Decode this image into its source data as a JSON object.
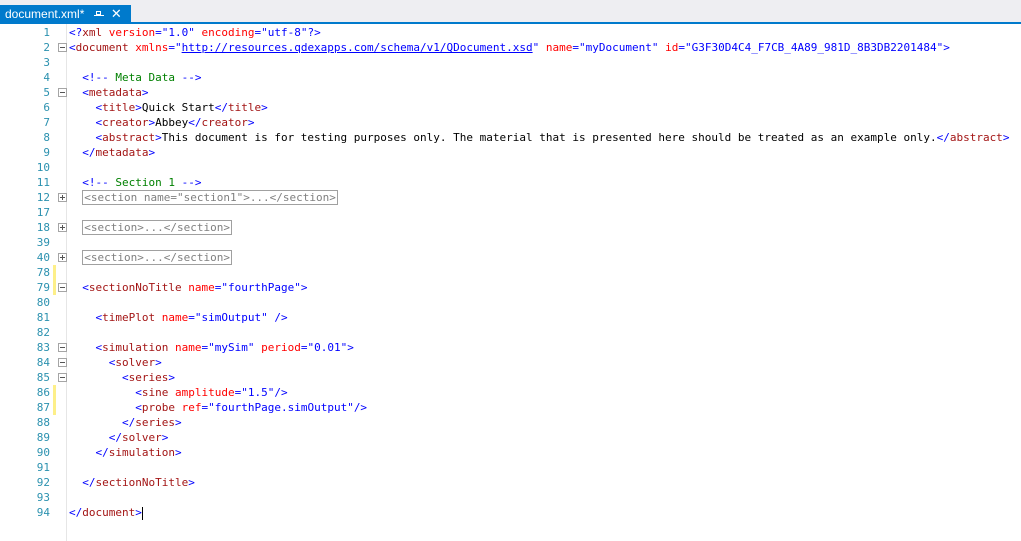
{
  "tab": {
    "title": "document.xml*",
    "pin_icon": "pin-icon",
    "close_label": "✕"
  },
  "colors": {
    "tab_active": "#007acc",
    "line_number": "#2b91af",
    "tag": "#a31515",
    "attribute": "#ff0000",
    "value": "#0000ff",
    "comment": "#008000",
    "changed_marker": "#fdef89"
  },
  "lines": [
    {
      "n": "1",
      "fold": "",
      "changed": false,
      "indent": 0,
      "tokens": [
        [
          "blue",
          "<?"
        ],
        [
          "tag",
          "xml"
        ],
        [
          "attr",
          " version"
        ],
        [
          "blue",
          "="
        ],
        [
          "blue",
          "\""
        ],
        [
          "val",
          "1.0"
        ],
        [
          "blue",
          "\""
        ],
        [
          "attr",
          " encoding"
        ],
        [
          "blue",
          "="
        ],
        [
          "blue",
          "\""
        ],
        [
          "val",
          "utf-8"
        ],
        [
          "blue",
          "\""
        ],
        [
          "blue",
          "?>"
        ]
      ]
    },
    {
      "n": "2",
      "fold": "open",
      "changed": false,
      "indent": 0,
      "tokens": [
        [
          "blue",
          "<"
        ],
        [
          "tag",
          "document"
        ],
        [
          "attr",
          " xmlns"
        ],
        [
          "blue",
          "="
        ],
        [
          "blue",
          "\""
        ],
        [
          "link",
          "http://resources.qdexapps.com/schema/v1/QDocument.xsd"
        ],
        [
          "blue",
          "\""
        ],
        [
          "attr",
          " name"
        ],
        [
          "blue",
          "="
        ],
        [
          "blue",
          "\""
        ],
        [
          "val",
          "myDocument"
        ],
        [
          "blue",
          "\""
        ],
        [
          "attr",
          " id"
        ],
        [
          "blue",
          "="
        ],
        [
          "blue",
          "\""
        ],
        [
          "val",
          "G3F30D4C4_F7CB_4A89_981D_8B3DB2201484"
        ],
        [
          "blue",
          "\""
        ],
        [
          "blue",
          ">"
        ]
      ]
    },
    {
      "n": "3",
      "fold": "",
      "changed": false,
      "indent": 0,
      "tokens": []
    },
    {
      "n": "4",
      "fold": "",
      "changed": false,
      "indent": 2,
      "tokens": [
        [
          "blue",
          "<!--"
        ],
        [
          "com",
          " Meta Data "
        ],
        [
          "blue",
          "-->"
        ]
      ]
    },
    {
      "n": "5",
      "fold": "open",
      "changed": false,
      "indent": 2,
      "tokens": [
        [
          "blue",
          "<"
        ],
        [
          "tag",
          "metadata"
        ],
        [
          "blue",
          ">"
        ]
      ]
    },
    {
      "n": "6",
      "fold": "",
      "changed": false,
      "indent": 4,
      "tokens": [
        [
          "blue",
          "<"
        ],
        [
          "tag",
          "title"
        ],
        [
          "blue",
          ">"
        ],
        [
          "text",
          "Quick Start"
        ],
        [
          "blue",
          "</"
        ],
        [
          "tag",
          "title"
        ],
        [
          "blue",
          ">"
        ]
      ]
    },
    {
      "n": "7",
      "fold": "",
      "changed": false,
      "indent": 4,
      "tokens": [
        [
          "blue",
          "<"
        ],
        [
          "tag",
          "creator"
        ],
        [
          "blue",
          ">"
        ],
        [
          "text",
          "Abbey"
        ],
        [
          "blue",
          "</"
        ],
        [
          "tag",
          "creator"
        ],
        [
          "blue",
          ">"
        ]
      ]
    },
    {
      "n": "8",
      "fold": "",
      "changed": false,
      "indent": 4,
      "tokens": [
        [
          "blue",
          "<"
        ],
        [
          "tag",
          "abstract"
        ],
        [
          "blue",
          ">"
        ],
        [
          "text",
          "This document is for testing purposes only. The material that is presented here should be treated as an example only."
        ],
        [
          "blue",
          "</"
        ],
        [
          "tag",
          "abstract"
        ],
        [
          "blue",
          ">"
        ]
      ]
    },
    {
      "n": "9",
      "fold": "",
      "changed": false,
      "indent": 2,
      "tokens": [
        [
          "blue",
          "</"
        ],
        [
          "tag",
          "metadata"
        ],
        [
          "blue",
          ">"
        ]
      ]
    },
    {
      "n": "10",
      "fold": "",
      "changed": false,
      "indent": 0,
      "tokens": []
    },
    {
      "n": "11",
      "fold": "",
      "changed": false,
      "indent": 2,
      "tokens": [
        [
          "blue",
          "<!--"
        ],
        [
          "com",
          " Section 1 "
        ],
        [
          "blue",
          "-->"
        ]
      ]
    },
    {
      "n": "12",
      "fold": "collapsed",
      "changed": false,
      "indent": 2,
      "tokens": [
        [
          "collapsed",
          "<section name=\"section1\">...</section>"
        ]
      ]
    },
    {
      "n": "17",
      "fold": "",
      "changed": false,
      "indent": 0,
      "tokens": []
    },
    {
      "n": "18",
      "fold": "collapsed",
      "changed": false,
      "indent": 2,
      "tokens": [
        [
          "collapsed",
          "<section>...</section>"
        ]
      ]
    },
    {
      "n": "39",
      "fold": "",
      "changed": false,
      "indent": 0,
      "tokens": []
    },
    {
      "n": "40",
      "fold": "collapsed",
      "changed": false,
      "indent": 2,
      "tokens": [
        [
          "collapsed",
          "<section>...</section>"
        ]
      ]
    },
    {
      "n": "78",
      "fold": "",
      "changed": true,
      "indent": 0,
      "tokens": []
    },
    {
      "n": "79",
      "fold": "open",
      "changed": true,
      "indent": 2,
      "tokens": [
        [
          "blue",
          "<"
        ],
        [
          "tag",
          "sectionNoTitle"
        ],
        [
          "attr",
          " name"
        ],
        [
          "blue",
          "="
        ],
        [
          "blue",
          "\""
        ],
        [
          "val",
          "fourthPage"
        ],
        [
          "blue",
          "\""
        ],
        [
          "blue",
          ">"
        ]
      ]
    },
    {
      "n": "80",
      "fold": "",
      "changed": false,
      "indent": 0,
      "tokens": []
    },
    {
      "n": "81",
      "fold": "",
      "changed": false,
      "indent": 4,
      "tokens": [
        [
          "blue",
          "<"
        ],
        [
          "tag",
          "timePlot"
        ],
        [
          "attr",
          " name"
        ],
        [
          "blue",
          "="
        ],
        [
          "blue",
          "\""
        ],
        [
          "val",
          "simOutput"
        ],
        [
          "blue",
          "\""
        ],
        [
          "blue",
          " />"
        ]
      ]
    },
    {
      "n": "82",
      "fold": "",
      "changed": false,
      "indent": 0,
      "tokens": []
    },
    {
      "n": "83",
      "fold": "open",
      "changed": false,
      "indent": 4,
      "tokens": [
        [
          "blue",
          "<"
        ],
        [
          "tag",
          "simulation"
        ],
        [
          "attr",
          " name"
        ],
        [
          "blue",
          "="
        ],
        [
          "blue",
          "\""
        ],
        [
          "val",
          "mySim"
        ],
        [
          "blue",
          "\""
        ],
        [
          "attr",
          " period"
        ],
        [
          "blue",
          "="
        ],
        [
          "blue",
          "\""
        ],
        [
          "val",
          "0.01"
        ],
        [
          "blue",
          "\""
        ],
        [
          "blue",
          ">"
        ]
      ]
    },
    {
      "n": "84",
      "fold": "open",
      "changed": false,
      "indent": 6,
      "tokens": [
        [
          "blue",
          "<"
        ],
        [
          "tag",
          "solver"
        ],
        [
          "blue",
          ">"
        ]
      ]
    },
    {
      "n": "85",
      "fold": "open",
      "changed": false,
      "indent": 8,
      "tokens": [
        [
          "blue",
          "<"
        ],
        [
          "tag",
          "series"
        ],
        [
          "blue",
          ">"
        ]
      ]
    },
    {
      "n": "86",
      "fold": "",
      "changed": true,
      "indent": 10,
      "tokens": [
        [
          "blue",
          "<"
        ],
        [
          "tag",
          "sine"
        ],
        [
          "attr",
          " amplitude"
        ],
        [
          "blue",
          "="
        ],
        [
          "blue",
          "\""
        ],
        [
          "val",
          "1.5"
        ],
        [
          "blue",
          "\""
        ],
        [
          "blue",
          "/>"
        ]
      ]
    },
    {
      "n": "87",
      "fold": "",
      "changed": true,
      "indent": 10,
      "tokens": [
        [
          "blue",
          "<"
        ],
        [
          "tag",
          "probe"
        ],
        [
          "attr",
          " ref"
        ],
        [
          "blue",
          "="
        ],
        [
          "blue",
          "\""
        ],
        [
          "val",
          "fourthPage.simOutput"
        ],
        [
          "blue",
          "\""
        ],
        [
          "blue",
          "/>"
        ]
      ]
    },
    {
      "n": "88",
      "fold": "",
      "changed": false,
      "indent": 8,
      "tokens": [
        [
          "blue",
          "</"
        ],
        [
          "tag",
          "series"
        ],
        [
          "blue",
          ">"
        ]
      ]
    },
    {
      "n": "89",
      "fold": "",
      "changed": false,
      "indent": 6,
      "tokens": [
        [
          "blue",
          "</"
        ],
        [
          "tag",
          "solver"
        ],
        [
          "blue",
          ">"
        ]
      ]
    },
    {
      "n": "90",
      "fold": "",
      "changed": false,
      "indent": 4,
      "tokens": [
        [
          "blue",
          "</"
        ],
        [
          "tag",
          "simulation"
        ],
        [
          "blue",
          ">"
        ]
      ]
    },
    {
      "n": "91",
      "fold": "",
      "changed": false,
      "indent": 0,
      "tokens": []
    },
    {
      "n": "92",
      "fold": "",
      "changed": false,
      "indent": 2,
      "tokens": [
        [
          "blue",
          "</"
        ],
        [
          "tag",
          "sectionNoTitle"
        ],
        [
          "blue",
          ">"
        ]
      ]
    },
    {
      "n": "93",
      "fold": "",
      "changed": false,
      "indent": 0,
      "tokens": []
    },
    {
      "n": "94",
      "fold": "",
      "changed": false,
      "indent": 0,
      "caret": true,
      "tokens": [
        [
          "blue",
          "</"
        ],
        [
          "tag",
          "document"
        ],
        [
          "blue",
          ">"
        ]
      ]
    }
  ]
}
